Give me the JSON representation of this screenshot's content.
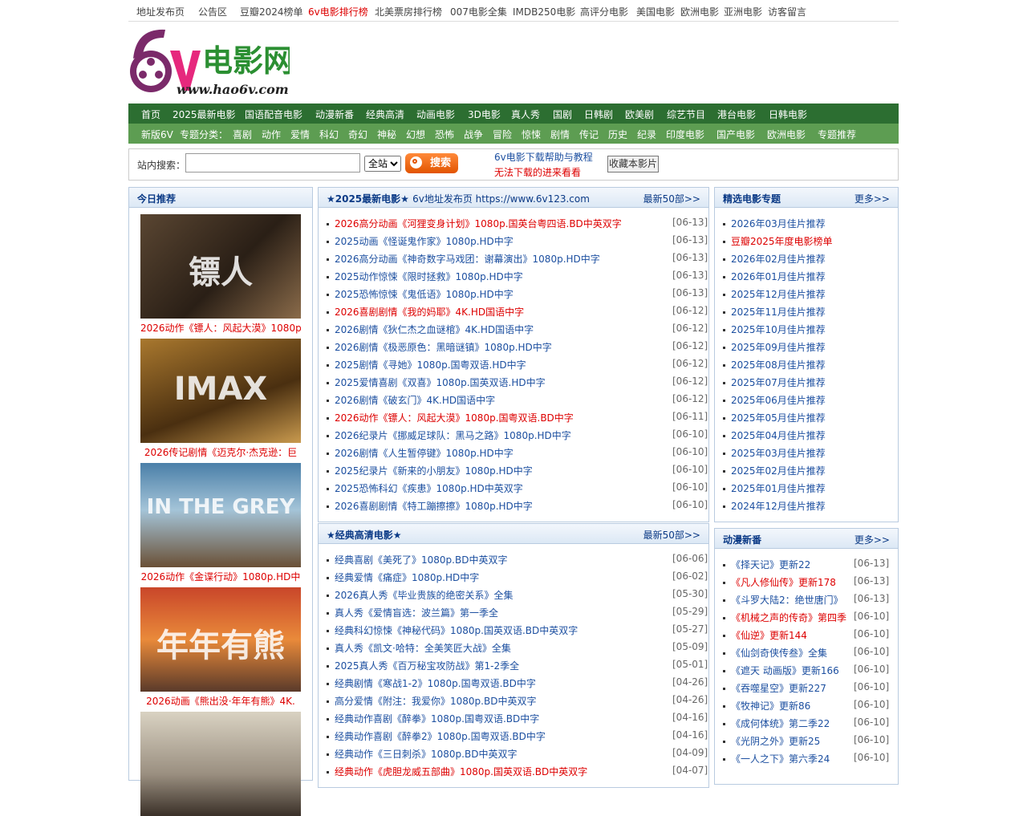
{
  "topnav": [
    {
      "label": "地址发布页",
      "red": false
    },
    {
      "label": "公告区",
      "red": false
    },
    {
      "label": "豆瓣2024榜单",
      "red": false
    },
    {
      "label": "6v电影排行榜",
      "red": true
    },
    {
      "label": "北美票房排行榜",
      "red": false
    },
    {
      "label": "007电影全集",
      "red": false
    },
    {
      "label": "IMDB250电影",
      "red": false
    },
    {
      "label": "高评分电影",
      "red": false
    },
    {
      "label": "美国电影",
      "red": false
    },
    {
      "label": "欧洲电影",
      "red": false
    },
    {
      "label": "亚洲电影",
      "red": false
    },
    {
      "label": "访客留言",
      "red": false
    }
  ],
  "logo": {
    "big": "电影网",
    "url": "www.hao6v.com",
    "digit": "6v"
  },
  "nav1": [
    "首页",
    "2025最新电影",
    "国语配音电影",
    "动漫新番",
    "经典高清",
    "动画电影",
    "3D电影",
    "真人秀",
    "国剧",
    "日韩剧",
    "欧美剧",
    "综艺节目",
    "港台电影",
    "日韩电影"
  ],
  "nav2": [
    "新版6V",
    "专题分类：",
    "喜剧",
    "动作",
    "爱情",
    "科幻",
    "奇幻",
    "神秘",
    "幻想",
    "恐怖",
    "战争",
    "冒险",
    "惊悚",
    "剧情",
    "传记",
    "历史",
    "纪录",
    "印度电影",
    "国产电影",
    "欧洲电影",
    "专题推荐"
  ],
  "search": {
    "label": "站内搜索：",
    "value": "",
    "select": "全站",
    "button": "搜索",
    "help": "6v电影下载帮助与教程",
    "help2": "无法下载的进来看看",
    "fav": "收藏本影片"
  },
  "today": {
    "title": "今日推荐",
    "items": [
      {
        "caption": "2026动作《镖人：风起大漠》1080p",
        "poster": "镖人"
      },
      {
        "caption": "2026传记剧情《迈克尔·杰克逊：巨",
        "poster": "IMAX"
      },
      {
        "caption": "2026动作《金谍行动》1080p.HD中",
        "poster": "IN THE GREY"
      },
      {
        "caption": "2026动画《熊出没·年年有熊》4K.",
        "poster": "年年有熊"
      },
      {
        "caption": "",
        "poster": ""
      }
    ]
  },
  "latest": {
    "title": "★2025最新电影★",
    "subtitle": "6v地址发布页 https://www.6v123.com",
    "more": "最新50部>>",
    "items": [
      {
        "text": "2026高分动画《河狸变身计划》1080p.国英台粤四语.BD中英双字",
        "date": "[06-13]",
        "red": true
      },
      {
        "text": "2025动画《怪诞鬼作家》1080p.HD中字",
        "date": "[06-13]",
        "red": false
      },
      {
        "text": "2026高分动画《神奇数字马戏团：谢幕演出》1080p.HD中字",
        "date": "[06-13]",
        "red": false
      },
      {
        "text": "2025动作惊悚《限时拯救》1080p.HD中字",
        "date": "[06-13]",
        "red": false
      },
      {
        "text": "2025恐怖惊悚《鬼低语》1080p.HD中字",
        "date": "[06-13]",
        "red": false
      },
      {
        "text": "2026喜剧剧情《我的妈耶》4K.HD国语中字",
        "date": "[06-12]",
        "red": true
      },
      {
        "text": "2026剧情《狄仁杰之血谜棺》4K.HD国语中字",
        "date": "[06-12]",
        "red": false
      },
      {
        "text": "2026剧情《极恶原色：黑暗谜镇》1080p.HD中字",
        "date": "[06-12]",
        "red": false
      },
      {
        "text": "2025剧情《寻她》1080p.国粤双语.HD中字",
        "date": "[06-12]",
        "red": false
      },
      {
        "text": "2025爱情喜剧《双喜》1080p.国英双语.HD中字",
        "date": "[06-12]",
        "red": false
      },
      {
        "text": "2026剧情《破玄门》4K.HD国语中字",
        "date": "[06-12]",
        "red": false
      },
      {
        "text": "2026动作《镖人：风起大漠》1080p.国粤双语.BD中字",
        "date": "[06-11]",
        "red": true
      },
      {
        "text": "2026纪录片《挪威足球队：黑马之路》1080p.HD中字",
        "date": "[06-10]",
        "red": false
      },
      {
        "text": "2026剧情《人生暂停键》1080p.HD中字",
        "date": "[06-10]",
        "red": false
      },
      {
        "text": "2025纪录片《新来的小朋友》1080p.HD中字",
        "date": "[06-10]",
        "red": false
      },
      {
        "text": "2025恐怖科幻《疾患》1080p.HD中英双字",
        "date": "[06-10]",
        "red": false
      },
      {
        "text": "2026喜剧剧情《特工蹦擦擦》1080p.HD中字",
        "date": "[06-10]",
        "red": false
      }
    ]
  },
  "classic": {
    "title": "★经典高清电影★",
    "more": "最新50部>>",
    "items": [
      {
        "text": "经典喜剧《美死了》1080p.BD中英双字",
        "date": "[06-06]",
        "red": false
      },
      {
        "text": "经典爱情《痛症》1080p.HD中字",
        "date": "[06-02]",
        "red": false
      },
      {
        "text": "2026真人秀《毕业贵族的绝密关系》全集",
        "date": "[05-30]",
        "red": false
      },
      {
        "text": "真人秀《爱情盲选：波兰篇》第一季全",
        "date": "[05-29]",
        "red": false
      },
      {
        "text": "经典科幻惊悚《神秘代码》1080p.国英双语.BD中英双字",
        "date": "[05-27]",
        "red": false
      },
      {
        "text": "真人秀《凯文·哈特：全美笑匠大战》全集",
        "date": "[05-09]",
        "red": false
      },
      {
        "text": "2025真人秀《百万秘宝攻防战》第1-2季全",
        "date": "[05-01]",
        "red": false
      },
      {
        "text": "经典剧情《寒战1-2》1080p.国粤双语.BD中字",
        "date": "[04-26]",
        "red": false
      },
      {
        "text": "高分爱情《附注：我爱你》1080p.BD中英双字",
        "date": "[04-26]",
        "red": false
      },
      {
        "text": "经典动作喜剧《醉拳》1080p.国粤双语.BD中字",
        "date": "[04-16]",
        "red": false
      },
      {
        "text": "经典动作喜剧《醉拳2》1080p.国粤双语.BD中字",
        "date": "[04-16]",
        "red": false
      },
      {
        "text": "经典动作《三日刺杀》1080p.BD中英双字",
        "date": "[04-09]",
        "red": false
      },
      {
        "text": "经典动作《虎胆龙威五部曲》1080p.国英双语.BD中英双字",
        "date": "[04-07]",
        "red": true
      }
    ]
  },
  "topics": {
    "title": "精选电影专题",
    "more": "更多>>",
    "items": [
      {
        "text": "2026年03月佳片推荐",
        "red": false
      },
      {
        "text": "豆瓣2025年度电影榜单",
        "red": true
      },
      {
        "text": "2026年02月佳片推荐",
        "red": false
      },
      {
        "text": "2026年01月佳片推荐",
        "red": false
      },
      {
        "text": "2025年12月佳片推荐",
        "red": false
      },
      {
        "text": "2025年11月佳片推荐",
        "red": false
      },
      {
        "text": "2025年10月佳片推荐",
        "red": false
      },
      {
        "text": "2025年09月佳片推荐",
        "red": false
      },
      {
        "text": "2025年08月佳片推荐",
        "red": false
      },
      {
        "text": "2025年07月佳片推荐",
        "red": false
      },
      {
        "text": "2025年06月佳片推荐",
        "red": false
      },
      {
        "text": "2025年05月佳片推荐",
        "red": false
      },
      {
        "text": "2025年04月佳片推荐",
        "red": false
      },
      {
        "text": "2025年03月佳片推荐",
        "red": false
      },
      {
        "text": "2025年02月佳片推荐",
        "red": false
      },
      {
        "text": "2025年01月佳片推荐",
        "red": false
      },
      {
        "text": "2024年12月佳片推荐",
        "red": false
      }
    ]
  },
  "anime": {
    "title": "动漫新番",
    "more": "更多>>",
    "items": [
      {
        "text": "《择天记》更新22",
        "date": "[06-13]",
        "red": false
      },
      {
        "text": "《凡人修仙传》更新178",
        "date": "[06-13]",
        "red": true
      },
      {
        "text": "《斗罗大陆2：绝世唐门》",
        "date": "[06-13]",
        "red": false
      },
      {
        "text": "《机械之声的传奇》第四季",
        "date": "[06-10]",
        "red": true
      },
      {
        "text": "《仙逆》更新144",
        "date": "[06-10]",
        "red": true
      },
      {
        "text": "《仙剑奇侠传叁》全集",
        "date": "[06-10]",
        "red": false
      },
      {
        "text": "《遮天 动画版》更新166",
        "date": "[06-10]",
        "red": false
      },
      {
        "text": "《吞噬星空》更新227",
        "date": "[06-10]",
        "red": false
      },
      {
        "text": "《牧神记》更新86",
        "date": "[06-10]",
        "red": false
      },
      {
        "text": "《成何体统》第二季22",
        "date": "[06-10]",
        "red": false
      },
      {
        "text": "《光阴之外》更新25",
        "date": "[06-10]",
        "red": false
      },
      {
        "text": "《一人之下》第六季24",
        "date": "[06-10]",
        "red": false
      }
    ]
  },
  "colors": {
    "nav_dark": "#2c6e31",
    "nav_light": "#5d9d52",
    "link": "#1c4fa0",
    "accent_red": "#d00"
  }
}
